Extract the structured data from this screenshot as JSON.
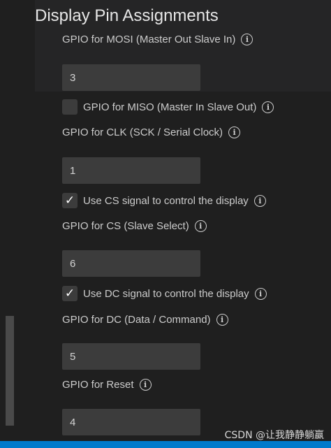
{
  "section": {
    "title": "Display Pin Assignments"
  },
  "icons": {
    "info": "info-icon",
    "checkmark": "check-icon"
  },
  "fields": {
    "mosi": {
      "label": "GPIO for MOSI (Master Out Slave In)",
      "value": "3"
    },
    "miso": {
      "label": "GPIO for MISO (Master In Slave Out)",
      "checked": false
    },
    "clk": {
      "label": "GPIO for CLK (SCK / Serial Clock)",
      "value": "1"
    },
    "cs_toggle": {
      "label": "Use CS signal to control the display",
      "checked": true
    },
    "cs": {
      "label": "GPIO for CS (Slave Select)",
      "value": "6"
    },
    "dc_toggle": {
      "label": "Use DC signal to control the display",
      "checked": true
    },
    "dc": {
      "label": "GPIO for DC (Data / Command)",
      "value": "5"
    },
    "reset": {
      "label": "GPIO for Reset",
      "value": "4"
    }
  },
  "watermark": "CSDN @让我静静躺赢",
  "colors": {
    "background": "#1f1f1f",
    "input": "#3c3c3c",
    "statusbar": "#007acc"
  }
}
